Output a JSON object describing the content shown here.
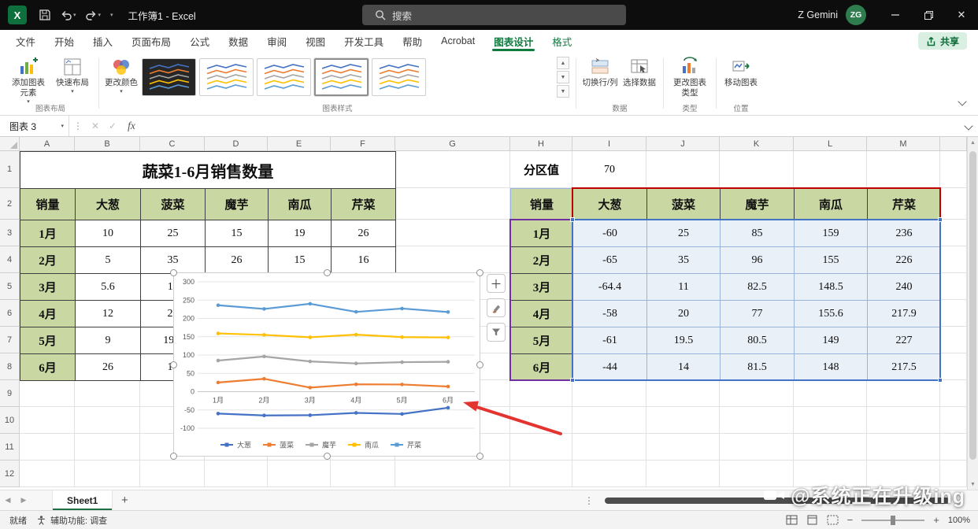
{
  "title_bar": {
    "workbook_title": "工作簿1 - Excel",
    "search_placeholder": "搜索",
    "user_name": "Z Gemini",
    "avatar_initials": "ZG"
  },
  "ribbon": {
    "tabs": [
      "文件",
      "开始",
      "插入",
      "页面布局",
      "公式",
      "数据",
      "审阅",
      "视图",
      "开发工具",
      "帮助",
      "Acrobat",
      "图表设计",
      "格式"
    ],
    "contextual_tabs": [
      "图表设计",
      "格式"
    ],
    "active_tab": "图表设计",
    "buttons": {
      "add_chart_element": "添加图表元素",
      "quick_layout": "快速布局",
      "change_colors": "更改颜色",
      "switch_row_col": "切换行/列",
      "select_data": "选择数据",
      "change_chart_type": "更改图表类型",
      "move_chart": "移动图表",
      "share": "共享"
    },
    "group_labels": [
      "图表布局",
      "图表样式",
      "数据",
      "类型",
      "位置"
    ]
  },
  "formula_bar": {
    "name_box": "图表 3",
    "fx": "fx"
  },
  "grid": {
    "columns": [
      "A",
      "B",
      "C",
      "D",
      "E",
      "F",
      "G",
      "H",
      "I",
      "J",
      "K",
      "L",
      "M"
    ],
    "rows": [
      "1",
      "2",
      "3",
      "4",
      "5",
      "6",
      "7",
      "8",
      "9",
      "10",
      "11",
      "12"
    ]
  },
  "left_table": {
    "title": "蔬菜1-6月销售数量",
    "headers": [
      "销量",
      "大葱",
      "菠菜",
      "魔芋",
      "南瓜",
      "芹菜"
    ],
    "rows": [
      {
        "month": "1月",
        "values": [
          "10",
          "25",
          "15",
          "19",
          "26"
        ]
      },
      {
        "month": "2月",
        "values": [
          "5",
          "35",
          "26",
          "15",
          "16"
        ]
      },
      {
        "month": "3月",
        "values": [
          "5.6",
          "11",
          "",
          "",
          ""
        ]
      },
      {
        "month": "4月",
        "values": [
          "12",
          "20",
          "",
          "",
          ""
        ]
      },
      {
        "month": "5月",
        "values": [
          "9",
          "19.5",
          "",
          "",
          ""
        ]
      },
      {
        "month": "6月",
        "values": [
          "26",
          "14",
          "",
          "",
          ""
        ]
      }
    ]
  },
  "partition": {
    "label": "分区值",
    "value": "70"
  },
  "right_table": {
    "headers": [
      "销量",
      "大葱",
      "菠菜",
      "魔芋",
      "南瓜",
      "芹菜"
    ],
    "rows": [
      {
        "month": "1月",
        "values": [
          "-60",
          "25",
          "85",
          "159",
          "236"
        ]
      },
      {
        "month": "2月",
        "values": [
          "-65",
          "35",
          "96",
          "155",
          "226"
        ]
      },
      {
        "month": "3月",
        "values": [
          "-64.4",
          "11",
          "82.5",
          "148.5",
          "240"
        ]
      },
      {
        "month": "4月",
        "values": [
          "-58",
          "20",
          "77",
          "155.6",
          "217.9"
        ]
      },
      {
        "month": "5月",
        "values": [
          "-61",
          "19.5",
          "80.5",
          "149",
          "227"
        ]
      },
      {
        "month": "6月",
        "values": [
          "-44",
          "14",
          "81.5",
          "148",
          "217.5"
        ]
      }
    ]
  },
  "chart_data": {
    "type": "line",
    "categories": [
      "1月",
      "2月",
      "3月",
      "4月",
      "5月",
      "6月"
    ],
    "series": [
      {
        "name": "大葱",
        "color": "#4472c4",
        "values": [
          -60,
          -65,
          -64.4,
          -58,
          -61,
          -44
        ]
      },
      {
        "name": "菠菜",
        "color": "#ed7d31",
        "values": [
          25,
          35,
          11,
          20,
          19.5,
          14
        ]
      },
      {
        "name": "魔芋",
        "color": "#a5a5a5",
        "values": [
          85,
          96,
          82.5,
          77,
          80.5,
          81.5
        ]
      },
      {
        "name": "南瓜",
        "color": "#ffc000",
        "values": [
          159,
          155,
          148.5,
          155.6,
          149,
          148
        ]
      },
      {
        "name": "芹菜",
        "color": "#5b9bd5",
        "values": [
          236,
          226,
          240,
          217.9,
          227,
          217.5
        ]
      }
    ],
    "ylim": [
      -100,
      300
    ],
    "ytick_step": 50,
    "grid": true,
    "legend_position": "bottom"
  },
  "sheet_bar": {
    "tab": "Sheet1",
    "add": "+"
  },
  "status_bar": {
    "ready": "就绪",
    "accessibility": "辅助功能: 调查",
    "zoom": "100%"
  },
  "watermark": {
    "text": "@系统正在升级ing"
  }
}
